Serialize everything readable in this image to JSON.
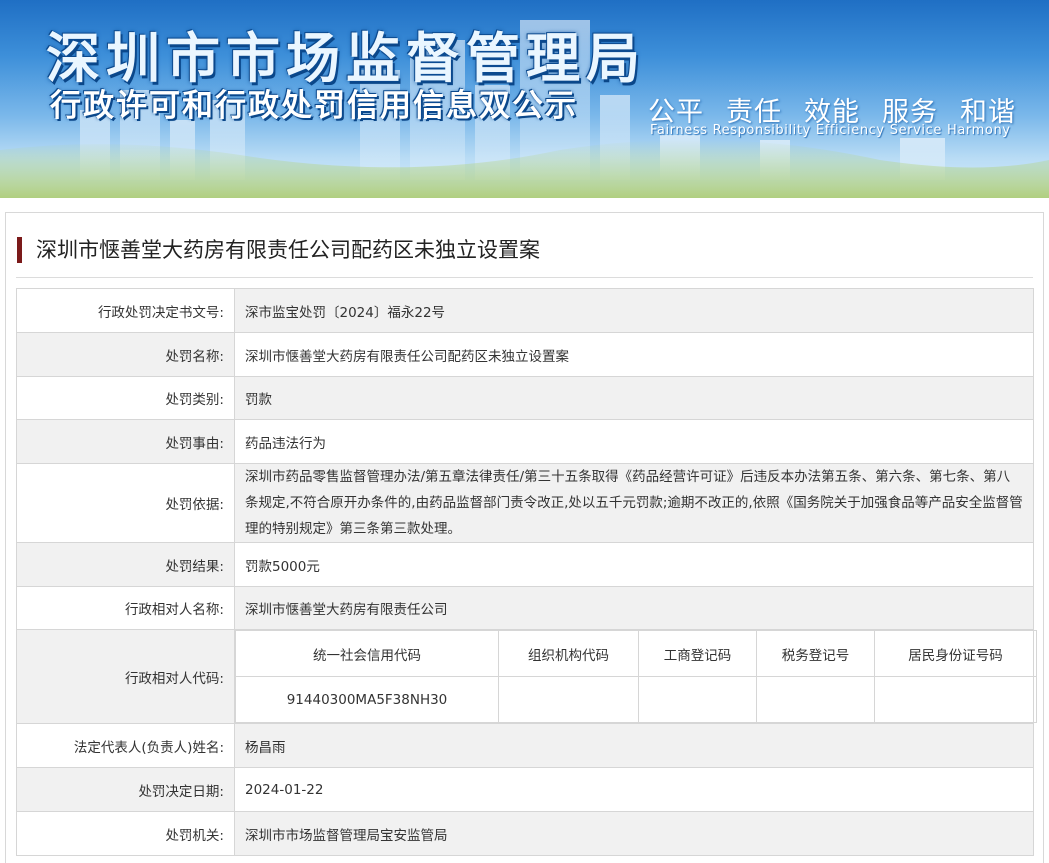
{
  "header": {
    "title": "深圳市市场监督管理局",
    "subtitle": "行政许可和行政处罚信用信息双公示",
    "motto_cn": [
      "公平",
      "责任",
      "效能",
      "服务",
      "和谐"
    ],
    "motto_en": [
      "Fairness",
      "Responsibility",
      "Efficiency",
      "Service",
      "Harmony"
    ]
  },
  "case": {
    "title": "深圳市惬善堂大药房有限责任公司配药区未独立设置案",
    "fields": {
      "decision_no_label": "行政处罚决定书文号:",
      "decision_no": "深市监宝处罚〔2024〕福永22号",
      "name_label": "处罚名称:",
      "name": "深圳市惬善堂大药房有限责任公司配药区未独立设置案",
      "category_label": "处罚类别:",
      "category": "罚款",
      "reason_label": "处罚事由:",
      "reason": "药品违法行为",
      "basis_label": "处罚依据:",
      "basis": "深圳市药品零售监督管理办法/第五章法律责任/第三十五条取得《药品经营许可证》后违反本办法第五条、第六条、第七条、第八条规定,不符合原开办条件的,由药品监督部门责令改正,处以五千元罚款;逾期不改正的,依照《国务院关于加强食品等产品安全监督管理的特别规定》第三条第三款处理。",
      "result_label": "处罚结果:",
      "result": "罚款5000元",
      "party_label": "行政相对人名称:",
      "party": "深圳市惬善堂大药房有限责任公司",
      "party_code_label": "行政相对人代码:",
      "legal_rep_label": "法定代表人(负责人)姓名:",
      "legal_rep": "杨昌雨",
      "date_label": "处罚决定日期:",
      "date": "2024-01-22",
      "authority_label": "处罚机关:",
      "authority": "深圳市市场监督管理局宝安监管局"
    },
    "codes": {
      "headers": [
        "统一社会信用代码",
        "组织机构代码",
        "工商登记码",
        "税务登记号",
        "居民身份证号码"
      ],
      "values": [
        "91440300MA5F38NH30",
        "",
        "",
        "",
        ""
      ]
    }
  },
  "colors": {
    "accent_bar": "#7b1a1a",
    "stripe": "#f1f1f1",
    "border": "#d6d6d6"
  }
}
